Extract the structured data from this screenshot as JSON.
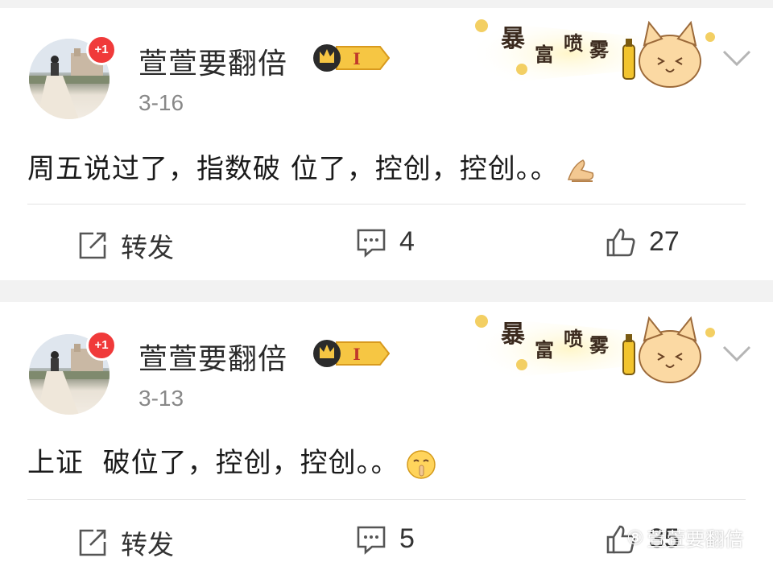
{
  "posts": [
    {
      "username": "萱萱要翻倍",
      "badge_count": "+1",
      "vip_level": "I",
      "date": "3-16",
      "decoration_text": [
        "暴",
        "富",
        "喷",
        "雾"
      ],
      "content": "周五说过了，指数破 位了，控创，控创。。",
      "content_emoji": "pray-hands-emoji",
      "actions": {
        "repost_label": "转发",
        "comment_count": "4",
        "like_count": "27"
      }
    },
    {
      "username": "萱萱要翻倍",
      "badge_count": "+1",
      "vip_level": "I",
      "date": "3-13",
      "decoration_text": [
        "暴",
        "富",
        "喷",
        "雾"
      ],
      "content": "上证  破位了，控创，控创。。",
      "content_emoji": "shush-face-emoji",
      "actions": {
        "repost_label": "转发",
        "comment_count": "5",
        "like_count": "35"
      }
    }
  ],
  "watermark": {
    "prefix": "⑧",
    "text": "萱萱要翻倍"
  },
  "colors": {
    "accent_red": "#f03a3a",
    "text_gray": "#888888",
    "gap_gray": "#f2f2f2",
    "vip_gold": "#f6c643"
  }
}
